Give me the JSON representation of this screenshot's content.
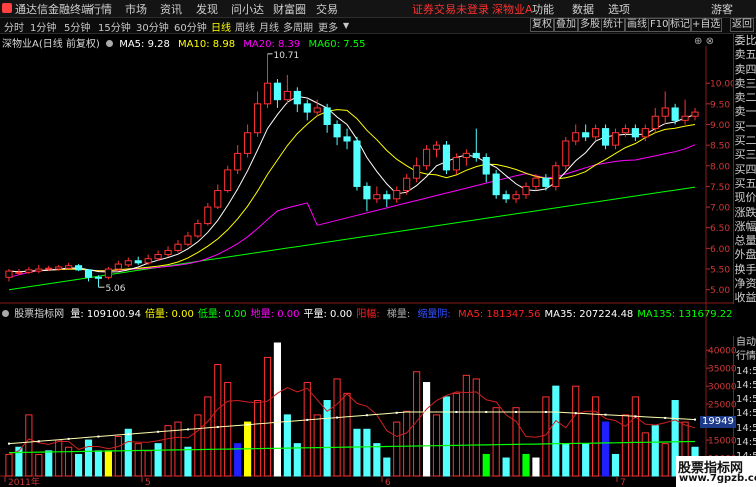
{
  "menubar": {
    "app_title": "通达信金融终端",
    "items": [
      "行情",
      "市场",
      "资讯",
      "发现",
      "问小达",
      "财富圈",
      "交易"
    ],
    "notice": "证券交易未登录",
    "stock": "深物业A",
    "right_items": [
      "功能",
      "数据",
      "选项",
      "游客"
    ]
  },
  "toolbar": {
    "periods": [
      "分时",
      "1分钟",
      "5分钟",
      "15分钟",
      "30分钟",
      "60分钟",
      "日线",
      "周线",
      "月线",
      "多周期",
      "更多"
    ],
    "active_period": "日线",
    "right_tools": [
      "复权",
      "叠加",
      "多股",
      "统计",
      "画线",
      "F10",
      "标记",
      "+自选",
      "返回"
    ]
  },
  "price_legend": {
    "title": "深物业A(日线 前复权)",
    "items": [
      {
        "label": "MA5: 9.28",
        "color": "#ffffff"
      },
      {
        "label": "MA10: 8.98",
        "color": "#ffff00"
      },
      {
        "label": "MA20: 8.39",
        "color": "#ff00ff"
      },
      {
        "label": "MA60: 7.55",
        "color": "#00ff00"
      }
    ]
  },
  "volume_legend": {
    "title": "股票指标网",
    "items": [
      {
        "label": "量: 109100.94",
        "color": "#ffffff"
      },
      {
        "label": "倍量: 0.00",
        "color": "#ffff00"
      },
      {
        "label": "低量: 0.00",
        "color": "#00ff00"
      },
      {
        "label": "地量: 0.00",
        "color": "#ff00ff"
      },
      {
        "label": "平量: 0.00",
        "color": "#ffffff"
      },
      {
        "label": "阳幅: ",
        "color": "#ff2020"
      },
      {
        "label": "梯量: ",
        "color": "#aaaaaa"
      },
      {
        "label": "缩量阴: ",
        "color": "#3050ff"
      },
      {
        "label": "MA5: 181347.56",
        "color": "#ff2020"
      },
      {
        "label": "MA35: 207224.48",
        "color": "#ffffff"
      },
      {
        "label": "MA135: 131679.22",
        "color": "#00ff00"
      }
    ]
  },
  "sidebar_price": [
    "委比",
    "卖五",
    "卖四",
    "卖三",
    "卖二",
    "卖一",
    "买一",
    "买二",
    "买三",
    "买四",
    "买五",
    "现价",
    "涨跌",
    "涨幅",
    "总量",
    "外盘",
    "换手",
    "净资",
    "收益"
  ],
  "sidebar_volume": [
    "自动",
    "行情",
    "14:5",
    "14:5",
    "14:5",
    "14:5",
    "14:5",
    "14:5",
    "14:5"
  ],
  "volume_badge": "19949",
  "watermark": {
    "line1": "股票指标网",
    "line2": "www.7gpzb.com"
  },
  "annotations": {
    "high": "10.71",
    "low": "5.06"
  },
  "date_labels": [
    "2011年",
    "5",
    "6",
    "7"
  ],
  "chart_data": [
    {
      "type": "candlestick",
      "title": "深物业A(日线 前复权)",
      "yticks": [
        5.0,
        5.5,
        6.0,
        6.5,
        7.0,
        7.5,
        8.0,
        8.5,
        9.0,
        9.5,
        10.0
      ],
      "ylim": [
        4.75,
        10.9
      ],
      "colors": {
        "up": "#ff3232",
        "down": "#54ffff",
        "ma5": "#ffffff",
        "ma10": "#ffff00",
        "ma20": "#ff00ff",
        "ma60": "#00ff00"
      },
      "candles": [
        [
          5.3,
          5.45,
          5.2,
          5.5
        ],
        [
          5.4,
          5.42,
          5.35,
          5.5
        ],
        [
          5.42,
          5.48,
          5.38,
          5.55
        ],
        [
          5.45,
          5.5,
          5.4,
          5.6
        ],
        [
          5.5,
          5.52,
          5.45,
          5.58
        ],
        [
          5.5,
          5.55,
          5.46,
          5.6
        ],
        [
          5.52,
          5.58,
          5.5,
          5.65
        ],
        [
          5.58,
          5.48,
          5.45,
          5.62
        ],
        [
          5.48,
          5.3,
          5.2,
          5.5
        ],
        [
          5.3,
          5.28,
          5.06,
          5.35
        ],
        [
          5.3,
          5.5,
          5.25,
          5.55
        ],
        [
          5.5,
          5.62,
          5.45,
          5.7
        ],
        [
          5.6,
          5.7,
          5.55,
          5.78
        ],
        [
          5.7,
          5.65,
          5.6,
          5.8
        ],
        [
          5.65,
          5.75,
          5.6,
          5.85
        ],
        [
          5.75,
          5.85,
          5.7,
          5.95
        ],
        [
          5.85,
          5.95,
          5.8,
          6.05
        ],
        [
          5.95,
          6.1,
          5.9,
          6.2
        ],
        [
          6.1,
          6.3,
          6.05,
          6.4
        ],
        [
          6.3,
          6.6,
          6.25,
          6.7
        ],
        [
          6.6,
          7.0,
          6.55,
          7.1
        ],
        [
          7.0,
          7.4,
          6.95,
          7.55
        ],
        [
          7.4,
          7.9,
          7.35,
          8.0
        ],
        [
          7.9,
          8.3,
          7.8,
          8.5
        ],
        [
          8.3,
          8.8,
          8.2,
          9.0
        ],
        [
          8.8,
          9.5,
          8.7,
          9.8
        ],
        [
          9.5,
          10.0,
          9.4,
          10.71
        ],
        [
          10.0,
          9.6,
          9.4,
          10.1
        ],
        [
          9.6,
          9.8,
          9.5,
          10.2
        ],
        [
          9.8,
          9.5,
          9.3,
          9.9
        ],
        [
          9.5,
          9.3,
          9.1,
          9.6
        ],
        [
          9.3,
          9.4,
          9.2,
          9.6
        ],
        [
          9.4,
          9.0,
          8.8,
          9.5
        ],
        [
          9.0,
          8.7,
          8.5,
          9.1
        ],
        [
          8.7,
          8.6,
          8.4,
          8.9
        ],
        [
          8.6,
          7.5,
          7.4,
          8.7
        ],
        [
          7.5,
          7.2,
          6.9,
          7.6
        ],
        [
          7.2,
          7.3,
          7.1,
          7.5
        ],
        [
          7.3,
          7.2,
          7.0,
          7.4
        ],
        [
          7.2,
          7.4,
          7.1,
          7.5
        ],
        [
          7.4,
          7.7,
          7.3,
          7.8
        ],
        [
          7.7,
          8.0,
          7.6,
          8.2
        ],
        [
          8.0,
          8.4,
          7.9,
          8.5
        ],
        [
          8.4,
          8.5,
          8.2,
          8.6
        ],
        [
          8.5,
          7.9,
          7.8,
          8.6
        ],
        [
          7.9,
          8.2,
          7.8,
          8.3
        ],
        [
          8.2,
          8.3,
          8.0,
          8.4
        ],
        [
          8.3,
          8.2,
          8.1,
          8.9
        ],
        [
          8.2,
          7.8,
          7.6,
          8.3
        ],
        [
          7.8,
          7.3,
          7.2,
          7.9
        ],
        [
          7.3,
          7.2,
          7.1,
          7.4
        ],
        [
          7.2,
          7.3,
          7.1,
          7.4
        ],
        [
          7.3,
          7.5,
          7.2,
          7.6
        ],
        [
          7.5,
          7.7,
          7.4,
          7.8
        ],
        [
          7.7,
          7.5,
          7.4,
          7.8
        ],
        [
          7.5,
          8.0,
          7.4,
          8.1
        ],
        [
          8.0,
          8.6,
          7.9,
          8.7
        ],
        [
          8.6,
          8.8,
          8.5,
          9.0
        ],
        [
          8.8,
          8.7,
          8.6,
          9.0
        ],
        [
          8.7,
          8.9,
          8.6,
          9.0
        ],
        [
          8.9,
          8.5,
          8.4,
          9.0
        ],
        [
          8.5,
          8.8,
          8.4,
          8.9
        ],
        [
          8.8,
          8.9,
          8.7,
          9.0
        ],
        [
          8.9,
          8.7,
          8.6,
          9.0
        ],
        [
          8.7,
          8.9,
          8.6,
          9.0
        ],
        [
          8.9,
          9.2,
          8.8,
          9.4
        ],
        [
          9.2,
          9.4,
          9.0,
          9.8
        ],
        [
          9.4,
          9.1,
          9.0,
          9.5
        ],
        [
          9.1,
          9.2,
          9.0,
          9.6
        ],
        [
          9.2,
          9.3,
          9.1,
          9.4
        ]
      ]
    },
    {
      "type": "bar",
      "title": "股票指标网",
      "yticks": [
        10000,
        15000,
        20000,
        25000,
        30000,
        35000,
        40000
      ],
      "ylim": [
        5000,
        42000
      ],
      "volumes": [
        11000,
        13000,
        22000,
        11000,
        12000,
        15000,
        13000,
        11000,
        15000,
        12000,
        12000,
        16000,
        18000,
        14000,
        12000,
        14000,
        19000,
        20000,
        13000,
        22000,
        27000,
        36000,
        31000,
        14000,
        20000,
        26000,
        38000,
        42000,
        22000,
        14000,
        31000,
        22000,
        26000,
        32000,
        28000,
        18000,
        18000,
        14000,
        10000,
        20000,
        23000,
        34000,
        31000,
        22000,
        27000,
        28000,
        33000,
        32000,
        11000,
        24000,
        10000,
        24000,
        11000,
        10000,
        27000,
        30000,
        14000,
        30000,
        14000,
        27000,
        20000,
        11000,
        22000,
        27000,
        17000,
        19000,
        14000,
        26000,
        20000,
        13000
      ],
      "vol_colors": [
        "up",
        "down",
        "up",
        "up",
        "down",
        "up",
        "up",
        "down",
        "down",
        "down",
        "yellow",
        "up",
        "down",
        "up",
        "up",
        "down",
        "up",
        "up",
        "down",
        "up",
        "up",
        "up",
        "up",
        "blue",
        "yellow",
        "up",
        "up",
        "white",
        "down",
        "down",
        "up",
        "up",
        "down",
        "up",
        "up",
        "down",
        "down",
        "down",
        "down",
        "up",
        "up",
        "up",
        "white",
        "up",
        "down",
        "up",
        "up",
        "up",
        "green",
        "up",
        "down",
        "up",
        "green",
        "white",
        "up",
        "down",
        "down",
        "up",
        "down",
        "up",
        "blue",
        "down",
        "up",
        "up",
        "up",
        "down",
        "up",
        "down",
        "up",
        "down"
      ]
    }
  ]
}
